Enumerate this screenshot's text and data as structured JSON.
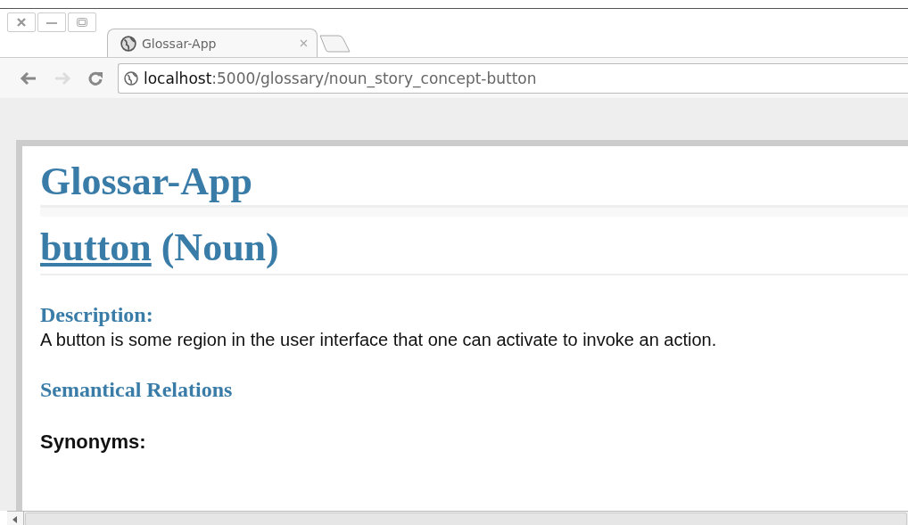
{
  "tabs": [
    {
      "title": "Glossar-App",
      "selected": true
    }
  ],
  "address_bar": {
    "host": "localhost",
    "path": ":5000/glossary/noun_story_concept-button"
  },
  "page": {
    "app_title": "Glossar-App",
    "term": {
      "word": "button",
      "suffix": "(Noun)"
    },
    "description_label": "Description:",
    "description": "A button is some region in the user interface that one can activate to invoke an action.",
    "section_title": "Semantical Relations",
    "synonyms_label": "Synonyms:"
  }
}
